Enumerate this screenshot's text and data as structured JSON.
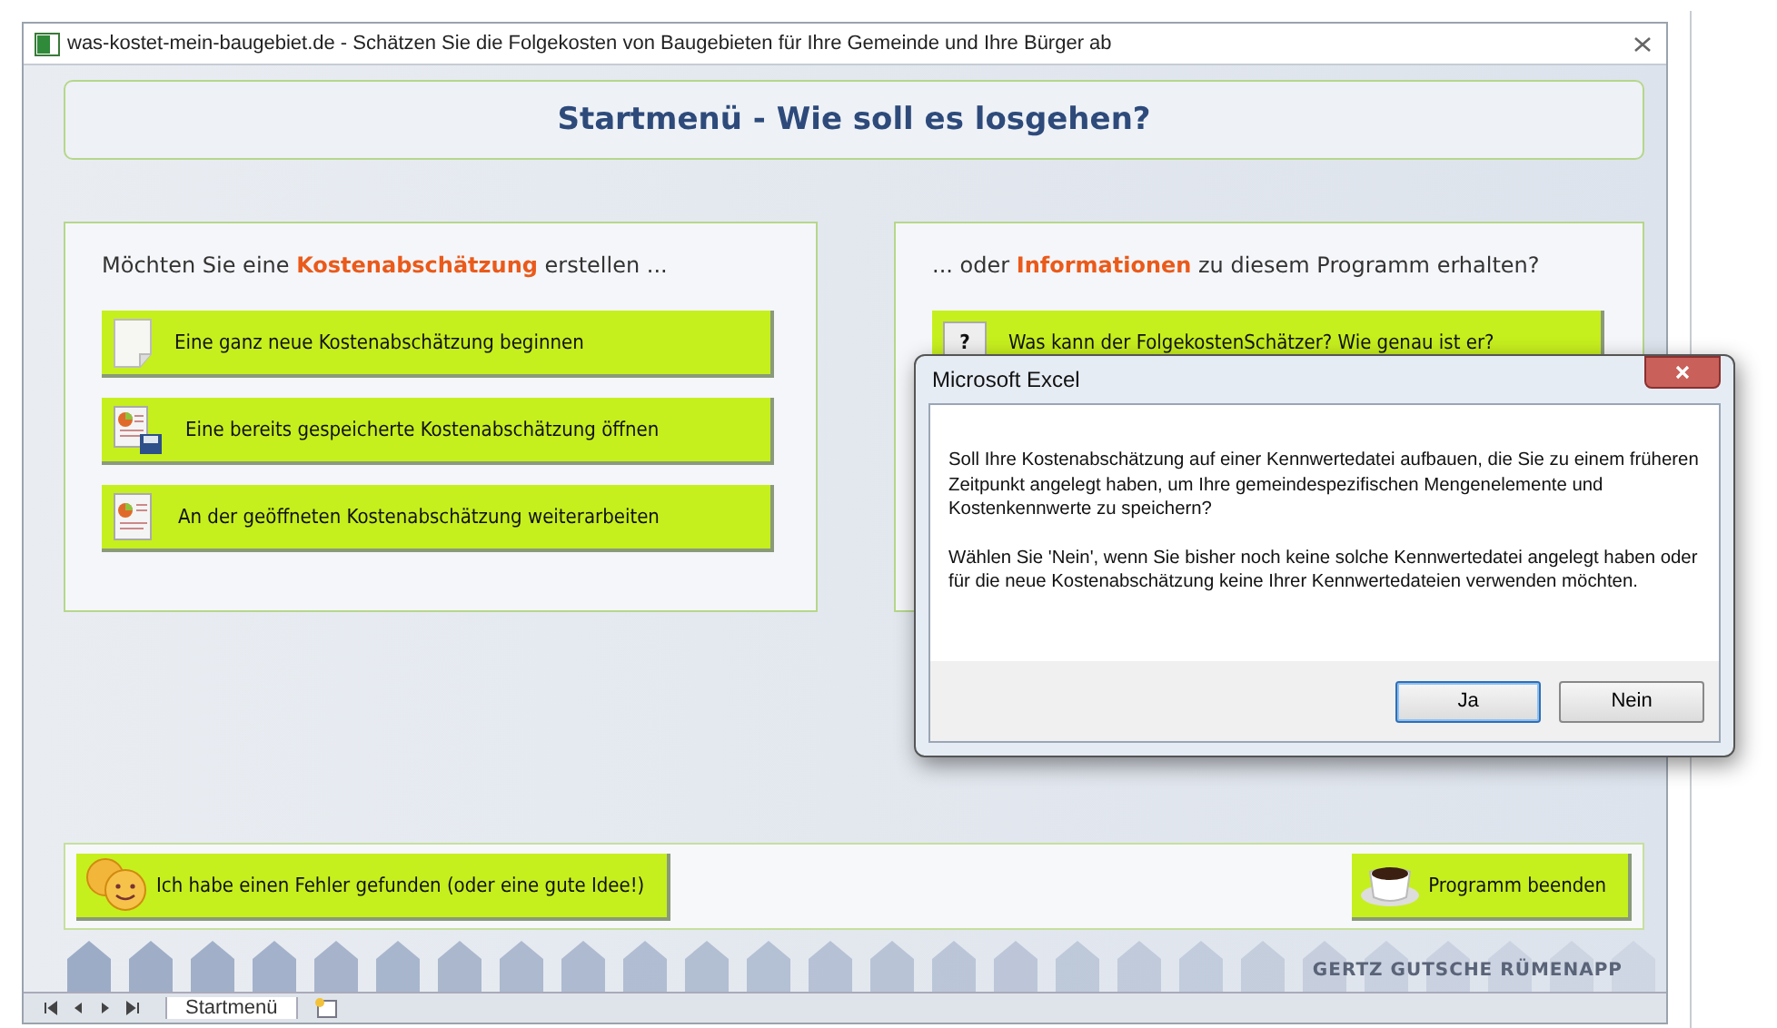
{
  "window": {
    "title": "was-kostet-mein-baugebiet.de - Schätzen Sie die Folgekosten von Baugebieten für Ihre Gemeinde und Ihre Bürger ab"
  },
  "header": {
    "title": "Startmenü - Wie soll es losgehen?"
  },
  "left_panel": {
    "prompt": "Möchten Sie eine **Kostenabschätzung** erstellen ...",
    "buttons": [
      {
        "kind": "new",
        "label": "Eine ganz neue Kostenabschätzung beginnen"
      },
      {
        "kind": "open",
        "label": "Eine bereits gespeicherte Kostenabschätzung öffnen"
      },
      {
        "kind": "continue",
        "label": "An der geöffneten Kostenabschätzung weiterarbeiten"
      }
    ]
  },
  "right_panel": {
    "prompt": "... oder **Informationen** zu diesem Programm erhalten?",
    "buttons": [
      {
        "kind": "help",
        "glyph": "?",
        "label": "Was kann der FolgekostenSchätzer? Wie genau ist er?"
      }
    ]
  },
  "footer": {
    "buttons": [
      {
        "kind": "feedback",
        "label": "Ich habe einen Fehler gefunden (oder eine gute Idee!)"
      },
      {
        "kind": "exit",
        "label": "Programm beenden"
      }
    ],
    "brand": "GERTZ GUTSCHE RÜMENAPP"
  },
  "sheet_tabs": [
    {
      "label": "Startmenü",
      "selected": true
    }
  ],
  "dialog": {
    "title": "Microsoft Excel",
    "paragraphs": [
      "Soll Ihre Kostenabschätzung auf einer Kennwertedatei aufbauen, die Sie zu einem früheren Zeitpunkt angelegt haben, um Ihre gemeindespezifischen Mengenelemente und Kostenkennwerte zu speichern?",
      "Wählen Sie 'Nein', wenn Sie bisher noch keine solche Kennwertedatei angelegt haben oder für die neue Kostenabschätzung keine Ihrer Kennwertedateien verwenden möchten."
    ],
    "buttons": [
      {
        "label": "Ja",
        "selected": true
      },
      {
        "label": "Nein",
        "selected": false
      }
    ]
  }
}
